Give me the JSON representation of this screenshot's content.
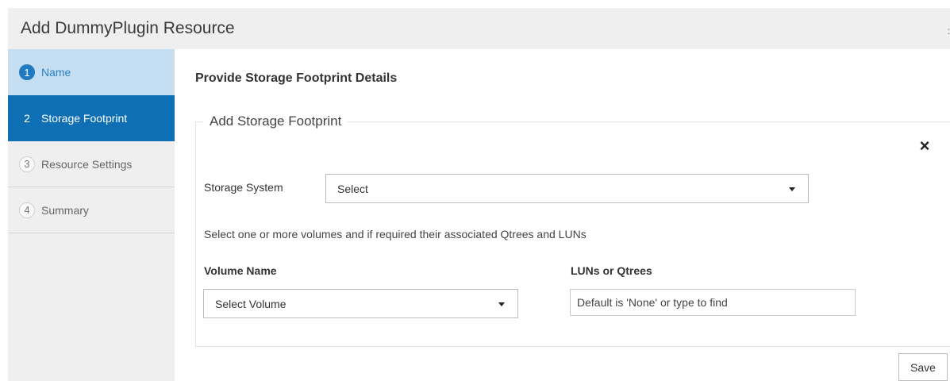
{
  "window": {
    "title": "Add DummyPlugin Resource",
    "corner_mark": ":"
  },
  "wizard": {
    "steps": [
      {
        "number": "1",
        "label": "Name"
      },
      {
        "number": "2",
        "label": "Storage Footprint"
      },
      {
        "number": "3",
        "label": "Resource Settings"
      },
      {
        "number": "4",
        "label": "Summary"
      }
    ],
    "active_step": 2,
    "colors": {
      "active": "#0e6fb5",
      "completed_bg": "#c5def2",
      "completed_text": "#2a7fc3"
    }
  },
  "main": {
    "heading": "Provide Storage Footprint Details",
    "panel": {
      "legend": "Add Storage Footprint",
      "close_icon": "×",
      "storage_system_label": "Storage System",
      "storage_system_value": "Select",
      "instructions": "Select one or more volumes and if required their associated Qtrees and LUNs",
      "volume_name_label": "Volume Name",
      "volume_value": "Select Volume",
      "luns_label": "LUNs or Qtrees",
      "luns_placeholder": "Default is 'None' or type to find"
    },
    "save_label": "Save"
  }
}
